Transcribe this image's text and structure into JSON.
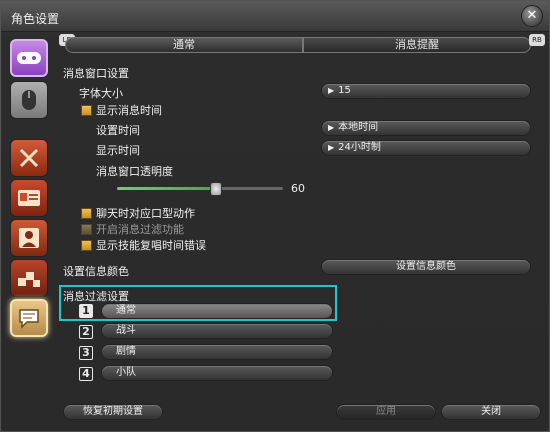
{
  "window": {
    "title": "角色设置"
  },
  "tabs": {
    "normal": "通常",
    "notify": "消息提醒",
    "lb": "LB",
    "rb": "RB"
  },
  "sidebar": [
    "gamepad-icon",
    "mouse-icon",
    "cross-swords-icon",
    "card-icon",
    "character-icon",
    "cubes-icon",
    "chat-icon"
  ],
  "section": {
    "message_window": "消息窗口设置",
    "font_size": {
      "label": "字体大小",
      "value": "15"
    },
    "show_time": {
      "label": "显示消息时间",
      "checked": true
    },
    "set_time": {
      "label": "设置时间",
      "value": "本地时间"
    },
    "display_time": {
      "label": "显示时间",
      "value": "24小时制"
    },
    "opacity": {
      "label": "消息窗口透明度",
      "value": "60",
      "fraction": 0.6
    },
    "chat_emote": {
      "label": "聊天时对应口型动作",
      "checked": true
    },
    "filter_enable": {
      "label": "开启消息过滤功能",
      "checked": false
    },
    "cast_error": {
      "label": "显示技能复唱时间错误",
      "checked": true
    },
    "info_color": {
      "label": "设置信息颜色",
      "button": "设置信息颜色"
    },
    "filter_settings": {
      "label": "消息过滤设置"
    }
  },
  "filters": [
    {
      "num": "1",
      "label": "通常"
    },
    {
      "num": "2",
      "label": "战斗"
    },
    {
      "num": "3",
      "label": "剧情"
    },
    {
      "num": "4",
      "label": "小队"
    }
  ],
  "footer": {
    "reset": "恢复初期设置",
    "apply": "应用",
    "close": "关闭"
  },
  "colors": {
    "highlight": "#1fc8c8",
    "checkbox": "#f0c060",
    "slider": "#6fcf6f"
  }
}
